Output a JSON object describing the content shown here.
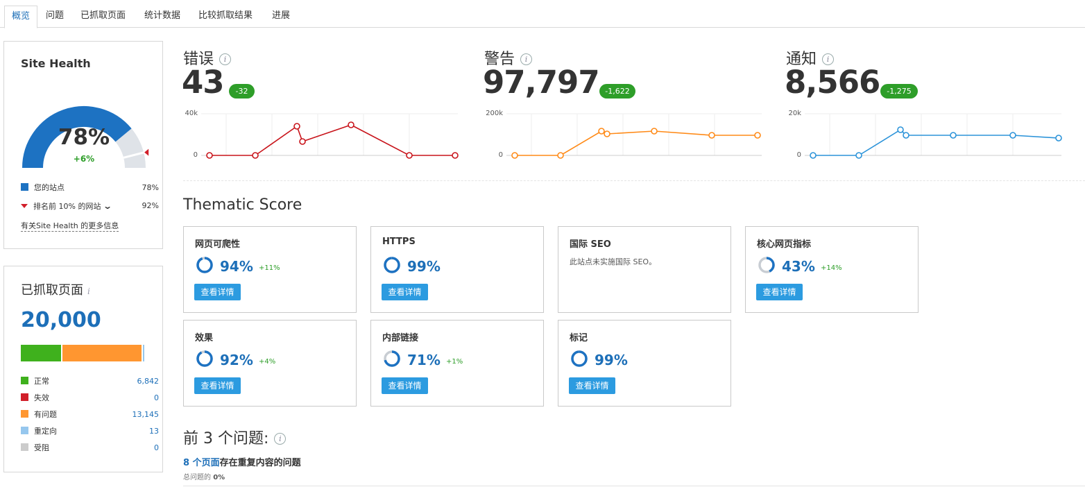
{
  "tabs": [
    "概览",
    "问题",
    "已抓取页面",
    "统计数据",
    "比较抓取结果",
    "进展"
  ],
  "site_health": {
    "title": "Site Health",
    "score": "78%",
    "change": "+6%",
    "score_fraction": 0.78,
    "top10_fraction": 0.92,
    "legend": [
      {
        "label": "您的站点",
        "value": "78%",
        "color": "#1d72c2"
      },
      {
        "label": "排名前 10% 的网站",
        "value": "92%",
        "color": "#d11f2a"
      }
    ],
    "more_info": "有关Site Health 的更多信息"
  },
  "crawled": {
    "title": "已抓取页面",
    "total": "20,000",
    "bar": [
      {
        "fraction": 0.3421,
        "color": "#3fb11d"
      },
      {
        "fraction": 0.0,
        "color": "#d11f2a"
      },
      {
        "fraction": 0.6573,
        "color": "#ff9630"
      },
      {
        "fraction": 0.00065,
        "color": "#96c7ee"
      },
      {
        "fraction": 0.0,
        "color": "#cccccc"
      }
    ],
    "legend": [
      {
        "label": "正常",
        "value": "6,842",
        "color": "#3fb11d"
      },
      {
        "label": "失效",
        "value": "0",
        "color": "#d11f2a"
      },
      {
        "label": "有问题",
        "value": "13,145",
        "color": "#ff9630"
      },
      {
        "label": "重定向",
        "value": "13",
        "color": "#96c7ee"
      },
      {
        "label": "受阻",
        "value": "0",
        "color": "#cccccc"
      }
    ]
  },
  "metrics": [
    {
      "title": "错误",
      "value": "43",
      "badge": "-32",
      "color": "#d0141b",
      "axis_top": "40k",
      "axis_zero": "0"
    },
    {
      "title": "警告",
      "value": "97,797",
      "badge": "-1,622",
      "color": "#ff8a17",
      "axis_top": "200k",
      "axis_zero": "0"
    },
    {
      "title": "通知",
      "value": "8,566",
      "badge": "-1,275",
      "color": "#2b93d9",
      "axis_top": "20k",
      "axis_zero": "0"
    }
  ],
  "thematic": {
    "title": "Thematic Score",
    "cards": [
      {
        "name": "网页可爬性",
        "pct": "94%",
        "fraction": 0.94,
        "delta": "+11%",
        "button": "查看详情"
      },
      {
        "name": "HTTPS",
        "pct": "99%",
        "fraction": 0.99,
        "delta": "",
        "button": "查看详情"
      },
      {
        "name": "国际 SEO",
        "note": "此站点未实施国际 SEO。"
      },
      {
        "name": "核心网页指标",
        "pct": "43%",
        "fraction": 0.43,
        "delta": "+14%",
        "button": "查看详情"
      },
      {
        "name": "效果",
        "pct": "92%",
        "fraction": 0.92,
        "delta": "+4%",
        "button": "查看详情"
      },
      {
        "name": "内部链接",
        "pct": "71%",
        "fraction": 0.71,
        "delta": "+1%",
        "button": "查看详情"
      },
      {
        "name": "标记",
        "pct": "99%",
        "fraction": 0.99,
        "delta": "",
        "button": "查看详情"
      }
    ]
  },
  "top_issues": {
    "title": "前 3 个问题:",
    "items": [
      {
        "link": "8 个页面",
        "text": "存在重复内容的问题",
        "sub_label": "总问题的",
        "sub_value": "0%"
      }
    ]
  }
}
